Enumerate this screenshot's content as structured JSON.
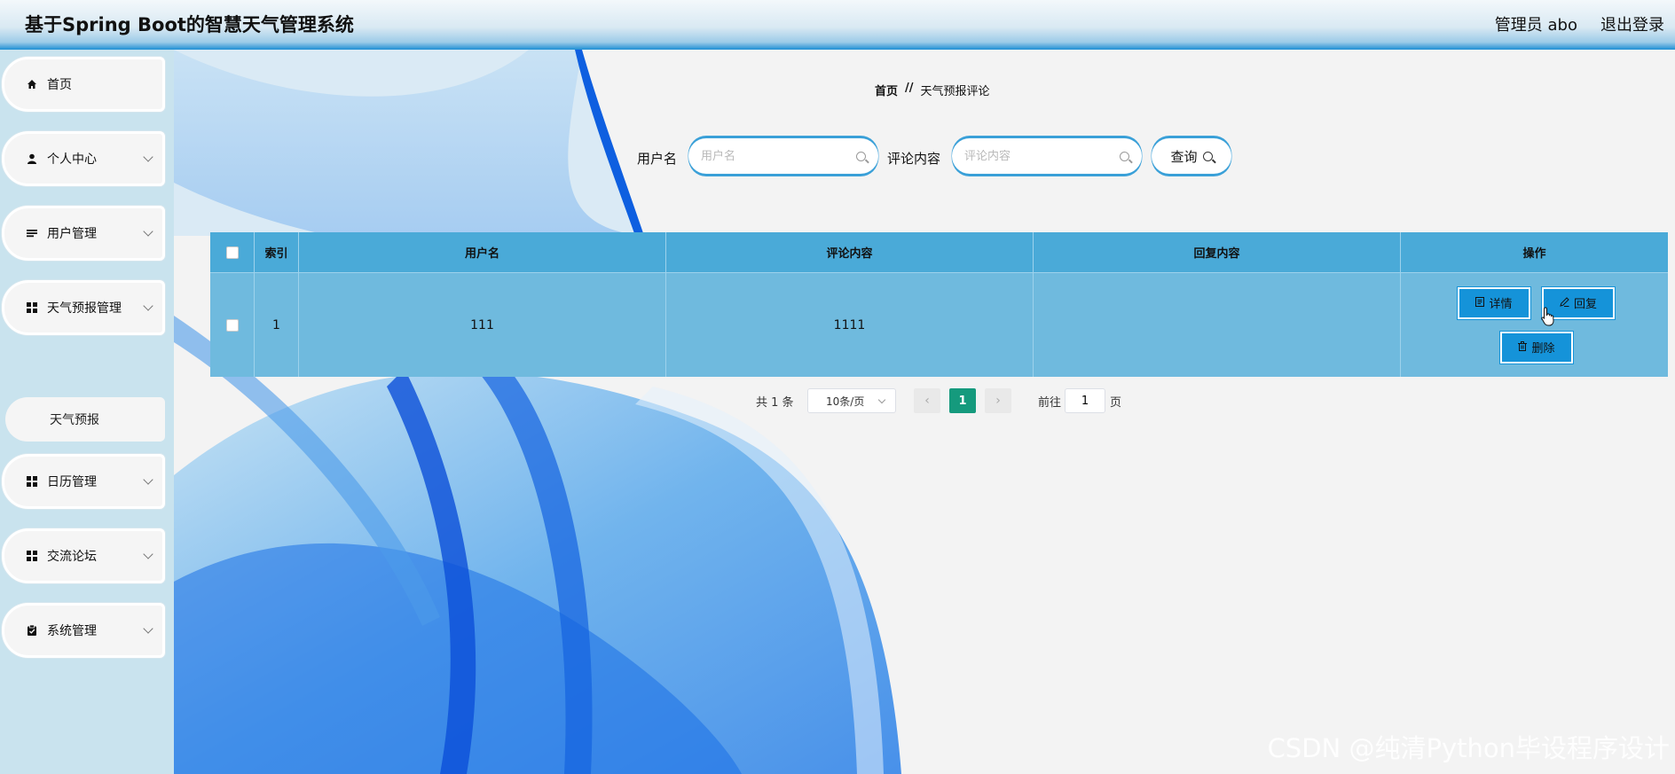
{
  "header": {
    "title": "基于Spring Boot的智慧天气管理系统",
    "user_label": "管理员 abo",
    "logout_label": "退出登录"
  },
  "sidebar": {
    "items": [
      {
        "label": "首页",
        "icon": "home-icon"
      },
      {
        "label": "个人中心",
        "icon": "user-icon"
      },
      {
        "label": "用户管理",
        "icon": "list-icon"
      },
      {
        "label": "天气预报管理",
        "icon": "grid-icon"
      },
      {
        "label": "日历管理",
        "icon": "grid-icon"
      },
      {
        "label": "交流论坛",
        "icon": "grid-icon"
      },
      {
        "label": "系统管理",
        "icon": "clipboard-icon"
      }
    ],
    "submenu": {
      "label": "天气预报"
    }
  },
  "breadcrumb": {
    "home": "首页",
    "separator": "//",
    "current": "天气预报评论"
  },
  "search": {
    "username_label": "用户名",
    "username_placeholder": "用户名",
    "comment_label": "评论内容",
    "comment_placeholder": "评论内容",
    "query_label": "查询"
  },
  "table": {
    "headers": {
      "index": "索引",
      "username": "用户名",
      "comment": "评论内容",
      "reply": "回复内容",
      "ops": "操作"
    },
    "rows": [
      {
        "index": "1",
        "username": "111",
        "comment": "1111",
        "reply": ""
      }
    ],
    "actions": {
      "detail": "详情",
      "reply": "回复",
      "delete": "删除"
    }
  },
  "pagination": {
    "total": "共 1 条",
    "page_size": "10条/页",
    "current_page": "1",
    "goto_prefix": "前往",
    "goto_value": "1",
    "goto_suffix": "页"
  },
  "watermark": "CSDN @纯清Python毕设程序设计",
  "colors": {
    "accent": "#1593d9",
    "table_header": "#4aaad8",
    "table_row": "#6fbade",
    "current_page": "#159a7d"
  }
}
